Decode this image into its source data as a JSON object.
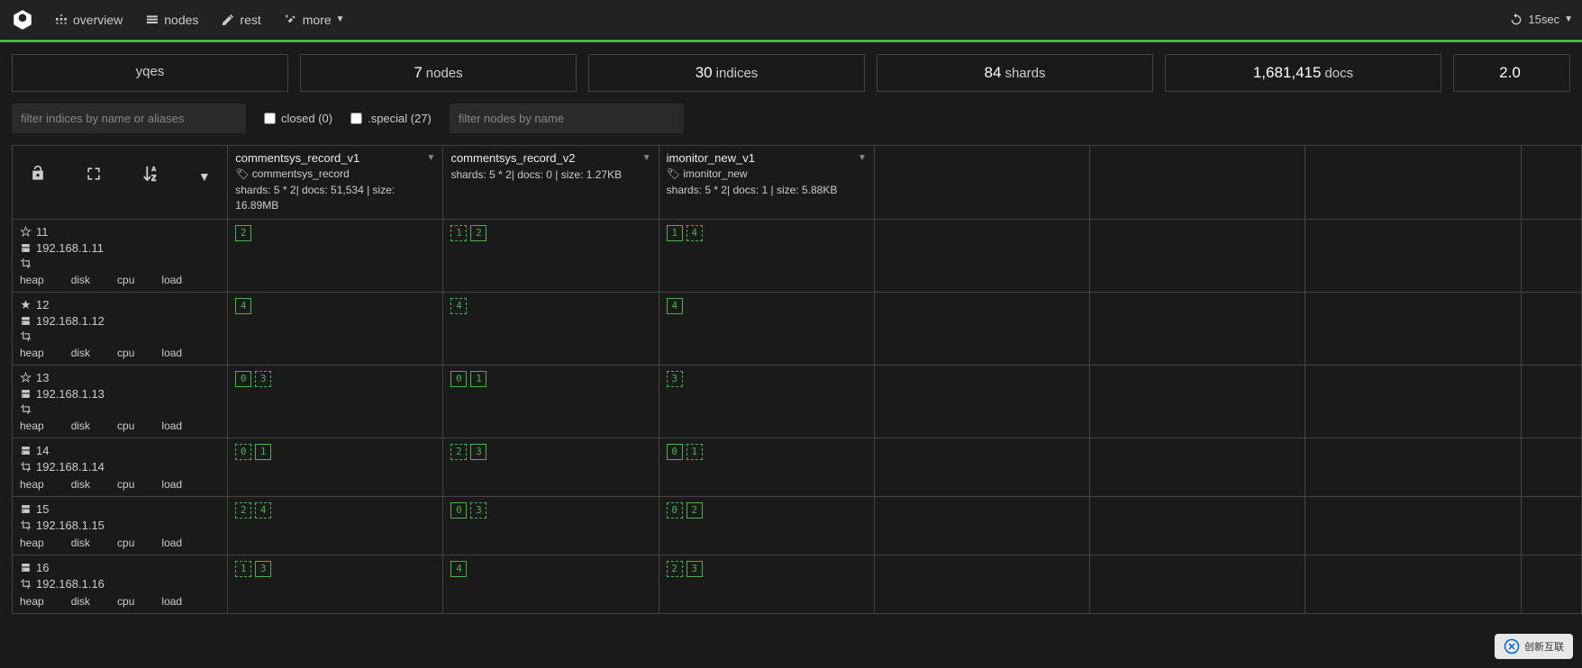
{
  "nav": {
    "overview": "overview",
    "nodes": "nodes",
    "rest": "rest",
    "more": "more",
    "refresh": "15sec"
  },
  "stats": {
    "cluster_name": "yqes",
    "nodes_num": "7",
    "nodes_label": "nodes",
    "indices_num": "30",
    "indices_label": "indices",
    "shards_num": "84",
    "shards_label": "shards",
    "docs_num": "1,681,415",
    "docs_label": "docs",
    "size_num": "2.0"
  },
  "filters": {
    "indices_placeholder": "filter indices by name or aliases",
    "closed_label": "closed (0)",
    "special_label": ".special (27)",
    "nodes_placeholder": "filter nodes by name"
  },
  "indices": [
    {
      "name": "commentsys_record_v1",
      "alias": "commentsys_record",
      "detail": "shards: 5 * 2| docs: 51,534 | size: 16.89MB"
    },
    {
      "name": "commentsys_record_v2",
      "alias": "",
      "detail": "shards: 5 * 2| docs: 0 | size: 1.27KB"
    },
    {
      "name": "imonitor_new_v1",
      "alias": "imonitor_new",
      "detail": "shards: 5 * 2| docs: 1 | size: 5.88KB"
    }
  ],
  "nodes": [
    {
      "name": "11",
      "ip": "192.168.1.11",
      "star": true,
      "crop": true,
      "stats": [
        "heap",
        "disk",
        "cpu",
        "load"
      ],
      "shards": [
        [
          {
            "n": "2",
            "p": true
          }
        ],
        [
          {
            "n": "1",
            "p": false
          },
          {
            "n": "2",
            "p": true
          }
        ],
        [
          {
            "n": "1",
            "p": true
          },
          {
            "n": "4",
            "p": false
          }
        ]
      ]
    },
    {
      "name": "12",
      "ip": "192.168.1.12",
      "star": "filled",
      "crop": true,
      "stats": [
        "heap",
        "disk",
        "cpu",
        "load"
      ],
      "shards": [
        [
          {
            "n": "4",
            "p": true
          }
        ],
        [
          {
            "n": "4",
            "p": false
          }
        ],
        [
          {
            "n": "4",
            "p": true
          }
        ]
      ]
    },
    {
      "name": "13",
      "ip": "192.168.1.13",
      "star": true,
      "crop": true,
      "stats": [
        "heap",
        "disk",
        "cpu",
        "load"
      ],
      "shards": [
        [
          {
            "n": "0",
            "p": true
          },
          {
            "n": "3",
            "p": false
          }
        ],
        [
          {
            "n": "0",
            "p": true
          },
          {
            "n": "1",
            "p": true
          }
        ],
        [
          {
            "n": "3",
            "p": false
          }
        ]
      ]
    },
    {
      "name": "14",
      "ip": "192.168.1.14",
      "star": false,
      "crop": true,
      "stats": [
        "heap",
        "disk",
        "cpu",
        "load"
      ],
      "shards": [
        [
          {
            "n": "0",
            "p": false
          },
          {
            "n": "1",
            "p": true
          }
        ],
        [
          {
            "n": "2",
            "p": false
          },
          {
            "n": "3",
            "p": true
          }
        ],
        [
          {
            "n": "0",
            "p": true
          },
          {
            "n": "1",
            "p": false
          }
        ]
      ]
    },
    {
      "name": "15",
      "ip": "192.168.1.15",
      "star": false,
      "crop": true,
      "stats": [
        "heap",
        "disk",
        "cpu",
        "load"
      ],
      "shards": [
        [
          {
            "n": "2",
            "p": false
          },
          {
            "n": "4",
            "p": false
          }
        ],
        [
          {
            "n": "0",
            "p": true
          },
          {
            "n": "3",
            "p": false
          }
        ],
        [
          {
            "n": "0",
            "p": false
          },
          {
            "n": "2",
            "p": true
          }
        ]
      ]
    },
    {
      "name": "16",
      "ip": "192.168.1.16",
      "star": false,
      "crop": true,
      "stats": [
        "heap",
        "disk",
        "cpu",
        "load"
      ],
      "shards": [
        [
          {
            "n": "1",
            "p": false
          },
          {
            "n": "3",
            "p": true
          }
        ],
        [
          {
            "n": "4",
            "p": true
          }
        ],
        [
          {
            "n": "2",
            "p": false
          },
          {
            "n": "3",
            "p": true
          }
        ]
      ]
    }
  ],
  "watermark": "创新互联"
}
